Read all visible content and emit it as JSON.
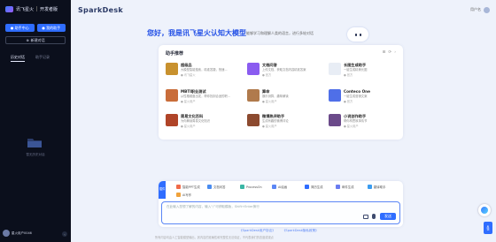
{
  "sidebar": {
    "logo_left": "讯飞星火",
    "logo_right": "开发者版",
    "btn_left": "● 助手中心",
    "btn_right": "● 我的助手",
    "new_chat": "新建对话",
    "tabs": [
      "历史对话",
      "助手记录"
    ],
    "empty_text": "暂无历史对话",
    "user_name": "星火用户0046",
    "collapse_glyph": "‹"
  },
  "topbar": {
    "brand": "SparkDesk",
    "user_label": "用户名"
  },
  "hero": {
    "title": "您好，我是讯飞星火认知大模型",
    "subtitle": "能够学习和理解人类的语言，进行多轮对话"
  },
  "card": {
    "heading": "助手推荐",
    "ctrl_grid": "⊞",
    "ctrl_refresh": "⟳",
    "ctrl_more": "›",
    "assistants": [
      {
        "name": "超级品",
        "desc": "大模型智能搜索，精准答疑，快速...",
        "author": "● 讯飞星火",
        "color": "#c8912e"
      },
      {
        "name": "文档问答",
        "desc": "上传文档，获取文档内容精准答案",
        "author": "● 官方",
        "color": "#8a5cf0"
      },
      {
        "name": "长图生成助手",
        "desc": "一键生成精美长图",
        "author": "● 官方",
        "color": "#e8edf5"
      },
      {
        "name": "MBTI职业测试",
        "desc": "从性格维度出发，帮你找到合适的职...",
        "author": "● 星火用户",
        "color": "#c96d3a"
      },
      {
        "name": "算命",
        "desc": "娱乐测算，趣味解读",
        "author": "● 星火用户",
        "color": "#b07a4c"
      },
      {
        "name": "Conteco One",
        "desc": "一键生成营销文案",
        "author": "● 官方",
        "color": "#4f6fe8"
      },
      {
        "name": "周易文化百科",
        "desc": "为你解读周易文化知识",
        "author": "● 星火用户",
        "color": "#b04428"
      },
      {
        "name": "微博热评助手",
        "desc": "生成有趣的微博评论",
        "author": "● 星火用户",
        "color": "#8c4a2f"
      },
      {
        "name": "小说创作助手",
        "desc": "帮你构思故事情节",
        "author": "● 星火用户",
        "color": "#6b4a8a"
      }
    ]
  },
  "input_panel": {
    "plugin_label": "插件",
    "plugins": [
      {
        "name": "智能PPT生成",
        "color": "#f06b4a"
      },
      {
        "name": "文档问答",
        "color": "#4a8cf0"
      },
      {
        "name": "ProcessOn",
        "color": "#3bb6a5"
      },
      {
        "name": "AI绘画",
        "color": "#5b86f5"
      },
      {
        "name": "简历生成",
        "color": "#2f6dff"
      },
      {
        "name": "邮件生成",
        "color": "#6a7cf0"
      },
      {
        "name": "翻译助手",
        "color": "#3b9cf0"
      },
      {
        "name": "AI写作",
        "color": "#f0a23b"
      }
    ],
    "placeholder": "在此输入您想了解的内容，输入“/”可获取模版，Shift+Enter换行",
    "send_label": "发送"
  },
  "footer": {
    "link_left": "《SparkDesk用户协议》",
    "link_right": "《SparkDesk隐私政策》",
    "note": "所有内容均由人工智能模型输出，其内容的准确性和完整性无法保证，不代表我们的态度或观点"
  },
  "side_flag": "反馈"
}
